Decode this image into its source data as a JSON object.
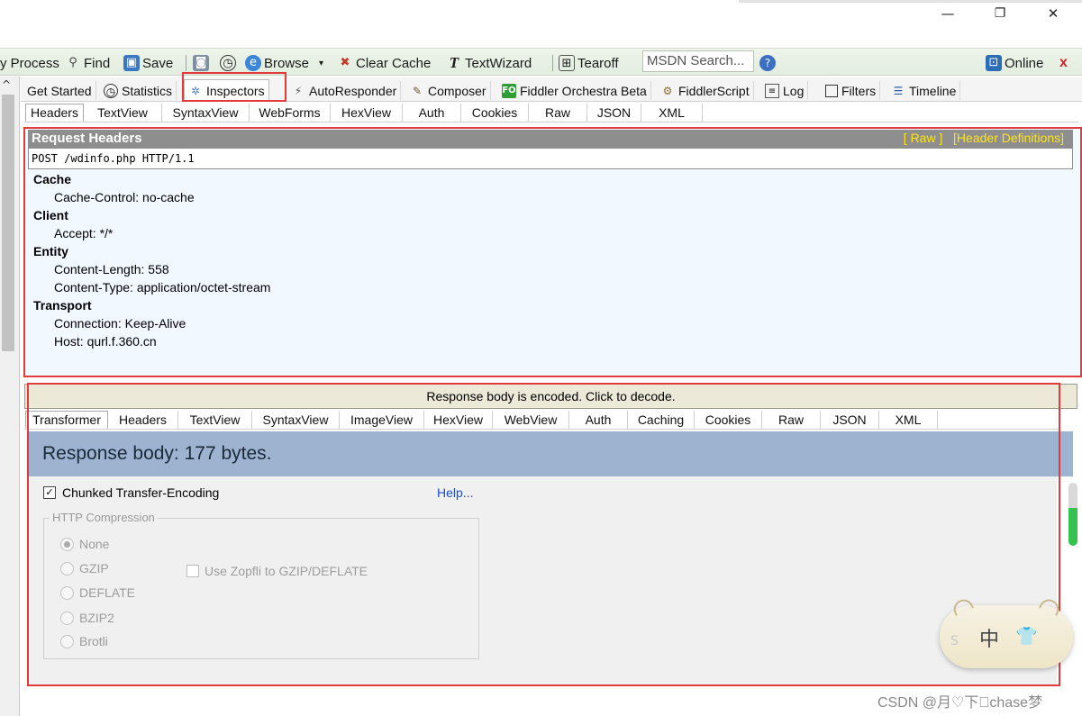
{
  "window": {
    "minimize_glyph": "—",
    "maximize_glyph": "❐",
    "close_glyph": "✕"
  },
  "toolbar": {
    "process": "y Process",
    "find": "Find",
    "save": "Save",
    "browse": "Browse",
    "clear_cache": "Clear Cache",
    "textwizard": "TextWizard",
    "tearoff": "Tearoff",
    "msdn_search": "MSDN Search...",
    "online": "Online"
  },
  "main_tabs": [
    {
      "label": "Get Started",
      "icon": ""
    },
    {
      "label": "Statistics",
      "icon": "stopwatch-icon"
    },
    {
      "label": "Inspectors",
      "icon": "magnifier-icon"
    },
    {
      "label": "AutoResponder",
      "icon": "lightning-icon"
    },
    {
      "label": "Composer",
      "icon": "pencil-icon"
    },
    {
      "label": "Fiddler Orchestra Beta",
      "icon": "fo-icon",
      "badge": "FO"
    },
    {
      "label": "FiddlerScript",
      "icon": "script-icon"
    },
    {
      "label": "Log",
      "icon": "log-icon"
    },
    {
      "label": "Filters",
      "icon": "checkbox-icon"
    },
    {
      "label": "Timeline",
      "icon": "timeline-icon"
    }
  ],
  "request_tabs": [
    "Headers",
    "TextView",
    "SyntaxView",
    "WebForms",
    "HexView",
    "Auth",
    "Cookies",
    "Raw",
    "JSON",
    "XML"
  ],
  "request_headers": {
    "title": "Request Headers",
    "raw_link": "[ Raw ]",
    "defs_link": "[Header Definitions]",
    "request_line": "POST /wdinfo.php HTTP/1.1",
    "groups": [
      {
        "name": "Cache",
        "items": [
          "Cache-Control: no-cache"
        ]
      },
      {
        "name": "Client",
        "items": [
          "Accept: */*"
        ]
      },
      {
        "name": "Entity",
        "items": [
          "Content-Length: 558",
          "Content-Type: application/octet-stream"
        ]
      },
      {
        "name": "Transport",
        "items": [
          "Connection: Keep-Alive",
          "Host: qurl.f.360.cn"
        ]
      }
    ]
  },
  "response": {
    "encoded_notice": "Response body is encoded. Click to decode.",
    "tabs": [
      "Transformer",
      "Headers",
      "TextView",
      "SyntaxView",
      "ImageView",
      "HexView",
      "WebView",
      "Auth",
      "Caching",
      "Cookies",
      "Raw",
      "JSON",
      "XML"
    ],
    "body_size": "Response body: 177 bytes.",
    "chunked_label": "Chunked Transfer-Encoding",
    "chunked_checked": true,
    "help": "Help...",
    "compression_legend": "HTTP Compression",
    "compression_options": [
      "None",
      "GZIP",
      "DEFLATE",
      "BZIP2",
      "Brotli"
    ],
    "compression_selected": "None",
    "zopfli_label": "Use Zopfli to GZIP/DEFLATE"
  },
  "ime": {
    "zh": "中",
    "s": "S"
  },
  "watermark": "CSDN @月♡下\u0000chase梦",
  "colors": {
    "highlight": "#e23b3b",
    "header_bar": "#8e8e8e",
    "links": "#ffe31a",
    "response_banner": "#9db3cf"
  }
}
